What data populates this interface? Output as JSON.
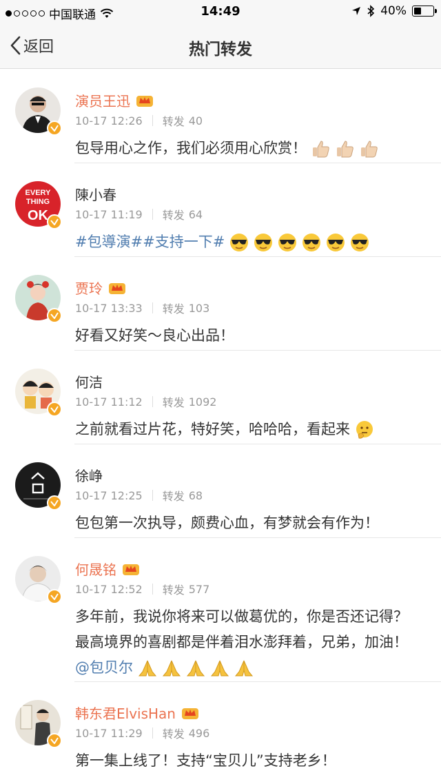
{
  "status_bar": {
    "carrier": "中国联通",
    "time": "14:49",
    "battery": "40%",
    "battery_level": 0.4
  },
  "nav": {
    "back_label": "返回",
    "title": "热门转发"
  },
  "repost_label": "转发",
  "items": [
    {
      "name": "演员王迅",
      "vip": true,
      "date": "10-17 12:26",
      "reposts": "40",
      "text": "包导用心之作，我们必须用心欣赏！",
      "emoji": "thumbs-up",
      "emoji_count": 3
    },
    {
      "name": "陳小春",
      "vip": false,
      "date": "10-17 11:19",
      "reposts": "64",
      "topics": [
        "#包導演#",
        "#支持一下#"
      ],
      "emoji": "sunglasses-face",
      "emoji_count": 6,
      "avatar_text": [
        "EVERY",
        "THING",
        "OK"
      ]
    },
    {
      "name": "贾玲",
      "vip": true,
      "date": "10-17 13:33",
      "reposts": "103",
      "text": "好看又好笑～良心出品！"
    },
    {
      "name": "何洁",
      "vip": false,
      "date": "10-17 11:12",
      "reposts": "1092",
      "text": "之前就看过片花，特好笑，哈哈哈，看起来",
      "emoji": "thinking-face",
      "emoji_count": 1
    },
    {
      "name": "徐峥",
      "vip": false,
      "date": "10-17 12:25",
      "reposts": "68",
      "text": "包包第一次执导，颇费心血，有梦就会有作为！"
    },
    {
      "name": "何晟铭",
      "vip": true,
      "date": "10-17 12:52",
      "reposts": "577",
      "text": "多年前，我说你将来可以做葛优的，你是否还记得？最高境界的喜剧都是伴着泪水澎拜着，兄弟，加油！",
      "mention": "@包贝尔",
      "emoji": "pray-hands",
      "emoji_count": 5
    },
    {
      "name": "韩东君ElvisHan",
      "vip": true,
      "date": "10-17 11:29",
      "reposts": "496",
      "text": "第一集上线了！支持“宝贝儿”支持老乡！"
    }
  ]
}
